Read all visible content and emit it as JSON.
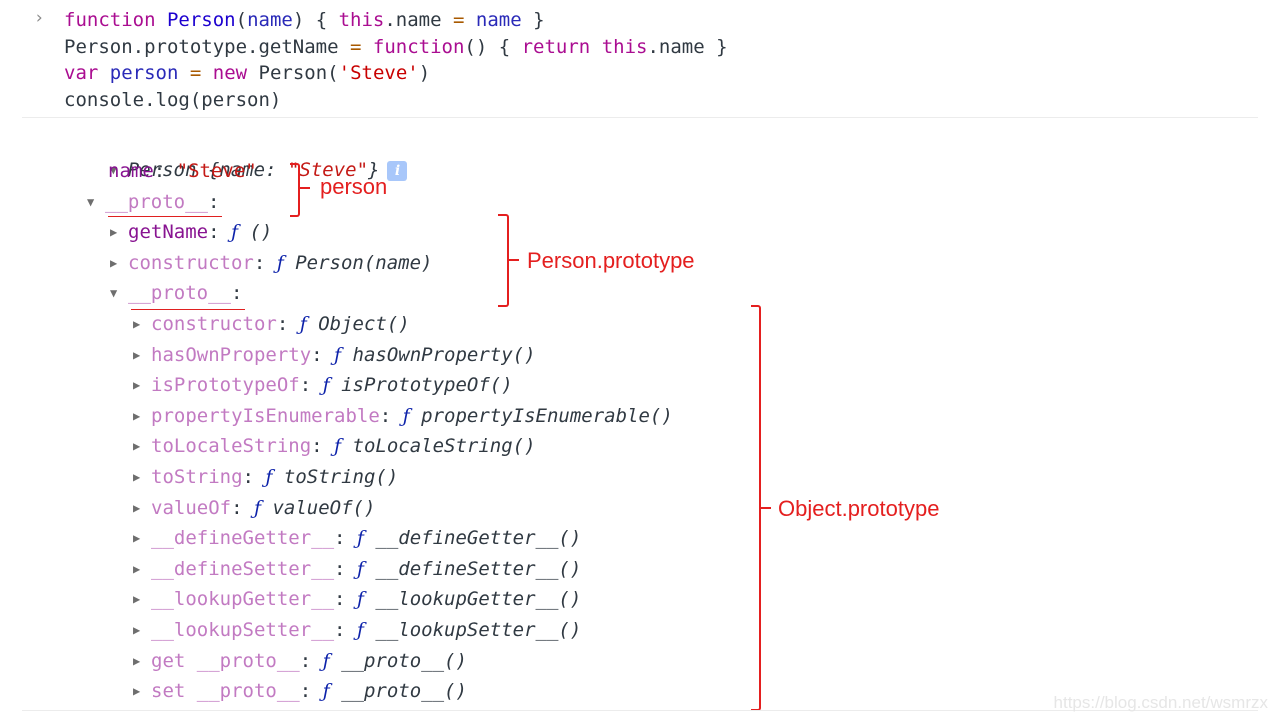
{
  "console_input": {
    "prompt_icon": "chevron-right-icon",
    "prompt_glyph": "›",
    "lines": [
      {
        "tokens": [
          {
            "t": "function",
            "c": "kw"
          },
          {
            "t": " ",
            "c": "plain"
          },
          {
            "t": "Person",
            "c": "fn-def"
          },
          {
            "t": "(",
            "c": "plain"
          },
          {
            "t": "name",
            "c": "ident"
          },
          {
            "t": ") { ",
            "c": "plain"
          },
          {
            "t": "this",
            "c": "kw"
          },
          {
            "t": ".name ",
            "c": "plain"
          },
          {
            "t": "=",
            "c": "op"
          },
          {
            "t": " ",
            "c": "plain"
          },
          {
            "t": "name",
            "c": "ident"
          },
          {
            "t": " }",
            "c": "plain"
          }
        ]
      },
      {
        "tokens": [
          {
            "t": "Person.prototype.getName ",
            "c": "plain"
          },
          {
            "t": "=",
            "c": "op"
          },
          {
            "t": " ",
            "c": "plain"
          },
          {
            "t": "function",
            "c": "kw"
          },
          {
            "t": "() { ",
            "c": "plain"
          },
          {
            "t": "return",
            "c": "kw"
          },
          {
            "t": " ",
            "c": "plain"
          },
          {
            "t": "this",
            "c": "kw"
          },
          {
            "t": ".name }",
            "c": "plain"
          }
        ]
      },
      {
        "tokens": [
          {
            "t": "var",
            "c": "kw"
          },
          {
            "t": " ",
            "c": "plain"
          },
          {
            "t": "person",
            "c": "ident"
          },
          {
            "t": " ",
            "c": "plain"
          },
          {
            "t": "=",
            "c": "op"
          },
          {
            "t": " ",
            "c": "plain"
          },
          {
            "t": "new",
            "c": "kw"
          },
          {
            "t": " Person(",
            "c": "plain"
          },
          {
            "t": "'Steve'",
            "c": "str"
          },
          {
            "t": ")",
            "c": "plain"
          }
        ]
      },
      {
        "tokens": [
          {
            "t": "console.log(person)",
            "c": "plain"
          }
        ]
      }
    ]
  },
  "console_output": {
    "root": {
      "expanded": true,
      "class_name": "Person",
      "preview_open": " {",
      "preview_key": "name",
      "preview_sep": ": ",
      "preview_value": "\"Steve\"",
      "preview_close": "}",
      "info_icon": "i"
    },
    "rows": [
      {
        "indent": 1,
        "arrow": "none",
        "key": "name",
        "key_kind": "own",
        "sep": ": ",
        "value_kind": "str",
        "value": "\"Steve\""
      },
      {
        "indent": 1,
        "arrow": "down",
        "key": "__proto__",
        "key_kind": "inh",
        "sep": ":",
        "value_kind": "none",
        "value": ""
      },
      {
        "indent": 2,
        "arrow": "right",
        "key": "getName",
        "key_kind": "own",
        "sep": ": ",
        "value_kind": "fn",
        "f": "ƒ",
        "value": " ()"
      },
      {
        "indent": 2,
        "arrow": "right",
        "key": "constructor",
        "key_kind": "inh",
        "sep": ": ",
        "value_kind": "fn",
        "f": "ƒ",
        "value": " Person(name)"
      },
      {
        "indent": 2,
        "arrow": "down",
        "key": "__proto__",
        "key_kind": "inh",
        "sep": ":",
        "value_kind": "none",
        "value": ""
      },
      {
        "indent": 3,
        "arrow": "right",
        "key": "constructor",
        "key_kind": "inh",
        "sep": ": ",
        "value_kind": "fn",
        "f": "ƒ",
        "value": " Object()"
      },
      {
        "indent": 3,
        "arrow": "right",
        "key": "hasOwnProperty",
        "key_kind": "inh",
        "sep": ": ",
        "value_kind": "fn",
        "f": "ƒ",
        "value": " hasOwnProperty()"
      },
      {
        "indent": 3,
        "arrow": "right",
        "key": "isPrototypeOf",
        "key_kind": "inh",
        "sep": ": ",
        "value_kind": "fn",
        "f": "ƒ",
        "value": " isPrototypeOf()"
      },
      {
        "indent": 3,
        "arrow": "right",
        "key": "propertyIsEnumerable",
        "key_kind": "inh",
        "sep": ": ",
        "value_kind": "fn",
        "f": "ƒ",
        "value": " propertyIsEnumerable()"
      },
      {
        "indent": 3,
        "arrow": "right",
        "key": "toLocaleString",
        "key_kind": "inh",
        "sep": ": ",
        "value_kind": "fn",
        "f": "ƒ",
        "value": " toLocaleString()"
      },
      {
        "indent": 3,
        "arrow": "right",
        "key": "toString",
        "key_kind": "inh",
        "sep": ": ",
        "value_kind": "fn",
        "f": "ƒ",
        "value": " toString()"
      },
      {
        "indent": 3,
        "arrow": "right",
        "key": "valueOf",
        "key_kind": "inh",
        "sep": ": ",
        "value_kind": "fn",
        "f": "ƒ",
        "value": " valueOf()"
      },
      {
        "indent": 3,
        "arrow": "right",
        "key": "__defineGetter__",
        "key_kind": "inh",
        "sep": ": ",
        "value_kind": "fn",
        "f": "ƒ",
        "value": " __defineGetter__()"
      },
      {
        "indent": 3,
        "arrow": "right",
        "key": "__defineSetter__",
        "key_kind": "inh",
        "sep": ": ",
        "value_kind": "fn",
        "f": "ƒ",
        "value": " __defineSetter__()"
      },
      {
        "indent": 3,
        "arrow": "right",
        "key": "__lookupGetter__",
        "key_kind": "inh",
        "sep": ": ",
        "value_kind": "fn",
        "f": "ƒ",
        "value": " __lookupGetter__()"
      },
      {
        "indent": 3,
        "arrow": "right",
        "key": "__lookupSetter__",
        "key_kind": "inh",
        "sep": ": ",
        "value_kind": "fn",
        "f": "ƒ",
        "value": " __lookupSetter__()"
      },
      {
        "indent": 3,
        "arrow": "right",
        "key": "get __proto__",
        "key_kind": "inh",
        "sep": ": ",
        "value_kind": "fn",
        "f": "ƒ",
        "value": " __proto__()"
      },
      {
        "indent": 3,
        "arrow": "right",
        "key": "set __proto__",
        "key_kind": "inh",
        "sep": ": ",
        "value_kind": "fn",
        "f": "ƒ",
        "value": " __proto__()"
      }
    ]
  },
  "annotations": {
    "person_label": "person",
    "person_prototype_label": "Person.prototype",
    "object_prototype_label": "Object.prototype",
    "color": "#e41f1f"
  },
  "watermark": "https://blog.csdn.net/wsmrzx"
}
